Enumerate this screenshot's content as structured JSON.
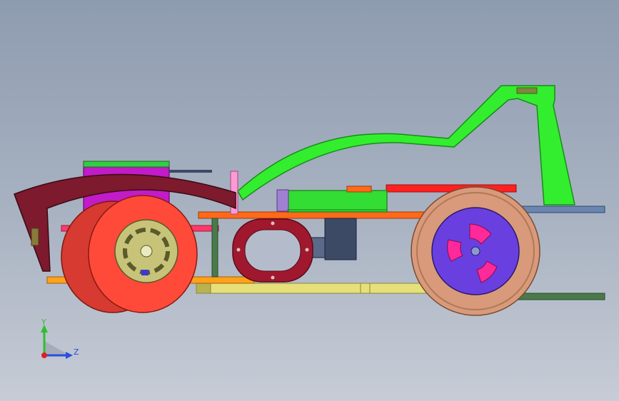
{
  "viewport": {
    "background_top": "#8e9cb0",
    "background_bottom": "#c7ccd6"
  },
  "triad": {
    "y_label": "Y",
    "z_label": "Z",
    "y_color": "#2fbf2f",
    "z_color": "#2a4ee0",
    "origin_color": "#e02020"
  },
  "parts": {
    "front_tire": "#ff4a3a",
    "front_tire_shadow": "#d63a30",
    "front_hub": "#c7c47a",
    "rear_tire": "#d89a7a",
    "rear_rim": "#6a3fe0",
    "rear_spokes": "#ff2a9a",
    "body_shell": "#33ee2e",
    "motor_block": "#c21bc8",
    "arch_frame": "#7d1a2e",
    "upper_plate": "#ff6a1a",
    "lower_plate": "#e6e07a",
    "side_rail": "#ffa21a",
    "battery_box": "#33dd33",
    "red_bar": "#ff2020",
    "blue_rail": "#6a86b0",
    "dark_rail": "#4a7a4a",
    "center_ring": "#a0182e",
    "gearbox": "#3c4a66",
    "pink_post": "#ff9ad6"
  }
}
